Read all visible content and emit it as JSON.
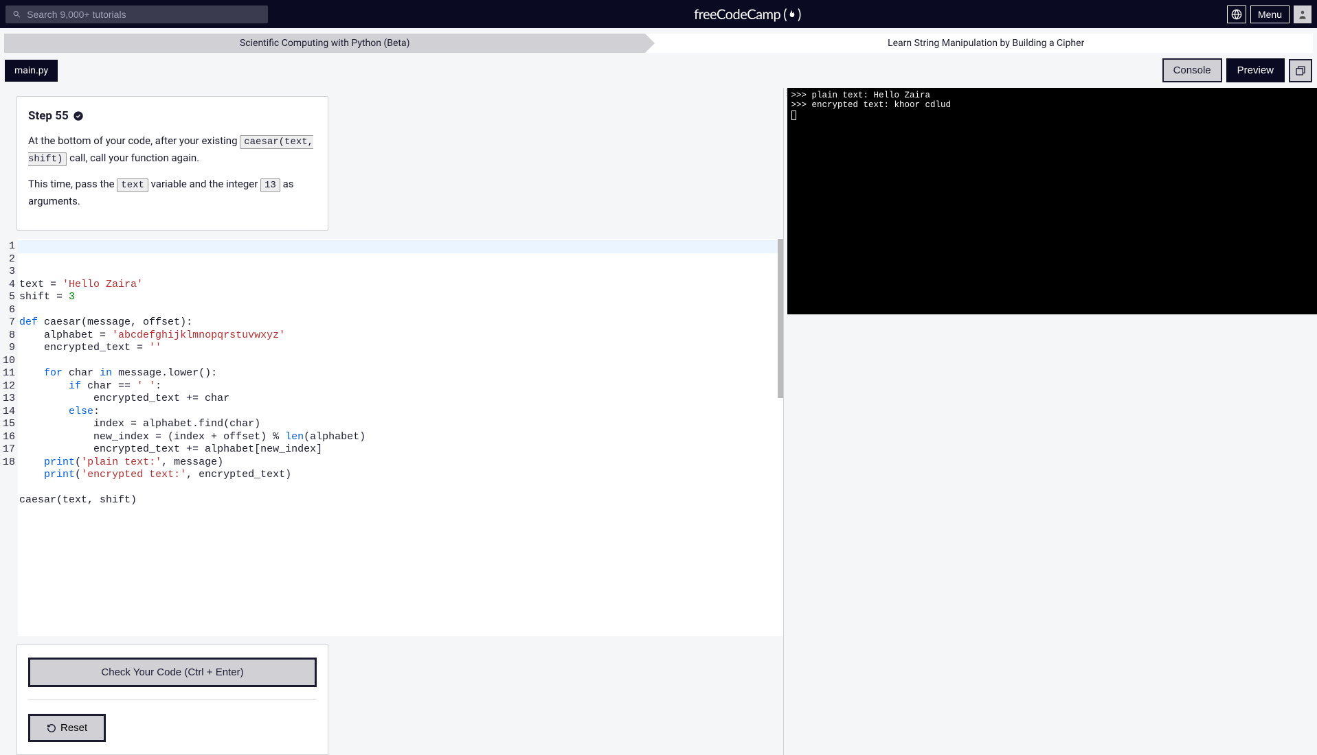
{
  "nav": {
    "search_placeholder": "Search 9,000+ tutorials",
    "brand": "freeCodeCamp",
    "menu_label": "Menu"
  },
  "breadcrumb": {
    "course": "Scientific Computing with Python (Beta)",
    "challenge": "Learn String Manipulation by Building a Cipher"
  },
  "tabs": {
    "file": "main.py",
    "console": "Console",
    "preview": "Preview"
  },
  "instructions": {
    "title": "Step 55",
    "p1_prefix": "At the bottom of your code, after your existing ",
    "p1_code": "caesar(text, shift)",
    "p1_suffix": " call, call your function again.",
    "p2_prefix": "This time, pass the ",
    "p2_code1": "text",
    "p2_mid": " variable and the integer ",
    "p2_code2": "13",
    "p2_suffix": " as arguments."
  },
  "editor": {
    "line_count": 18,
    "lines": {
      "l1": {
        "a": "text = ",
        "str": "'Hello Zaira'"
      },
      "l2": {
        "a": "shift = ",
        "num": "3"
      },
      "l3": "",
      "l4": {
        "kw1": "def",
        "a": " caesar(message, offset):"
      },
      "l5": {
        "a": "    alphabet = ",
        "str": "'abcdefghijklmnopqrstuvwxyz'"
      },
      "l6": {
        "a": "    encrypted_text = ",
        "str": "''"
      },
      "l7": "",
      "l8": {
        "a": "    ",
        "kw1": "for",
        "b": " char ",
        "kw2": "in",
        "c": " message.lower():"
      },
      "l9": {
        "a": "        ",
        "kw1": "if",
        "b": " char == ",
        "str": "' '",
        "c": ":"
      },
      "l10": "            encrypted_text += char",
      "l11": {
        "a": "        ",
        "kw1": "else",
        "b": ":"
      },
      "l12": "            index = alphabet.find(char)",
      "l13": {
        "a": "            new_index = (index + offset) % ",
        "builtin": "len",
        "b": "(alphabet)"
      },
      "l14": "            encrypted_text += alphabet[new_index]",
      "l15": {
        "a": "    ",
        "builtin": "print",
        "b": "(",
        "str": "'plain text:'",
        "c": ", message)"
      },
      "l16": {
        "a": "    ",
        "builtin": "print",
        "b": "(",
        "str": "'encrypted text:'",
        "c": ", encrypted_text)"
      },
      "l17": "",
      "l18": "caesar(text, shift)"
    }
  },
  "actions": {
    "check_label": "Check Your Code (Ctrl + Enter)",
    "reset_label": "Reset"
  },
  "console": {
    "line1": ">>> plain text: Hello Zaira",
    "line2": ">>> encrypted text: khoor cdlud"
  }
}
